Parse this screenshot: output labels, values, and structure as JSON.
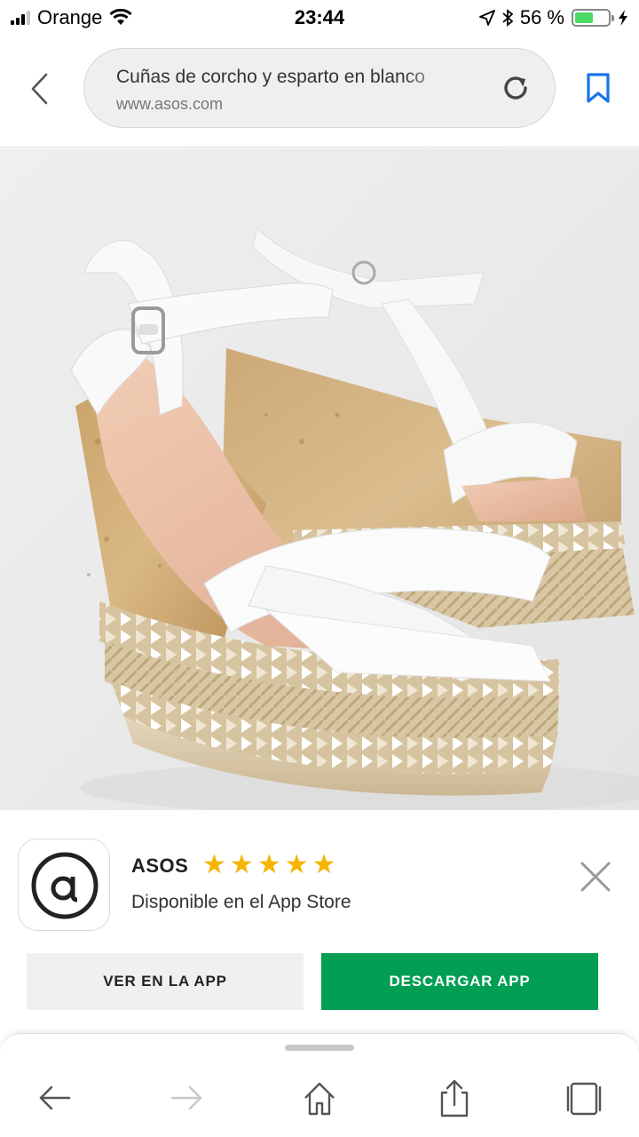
{
  "status": {
    "carrier": "Orange",
    "time": "23:44",
    "battery_pct": "56 %",
    "battery_level": 0.56,
    "battery_color": "#4cd964"
  },
  "browser": {
    "page_title": "Cuñas de corcho y esparto en blanco",
    "host": "www.asos.com",
    "icons": [
      "chevron-left-icon",
      "reload-icon",
      "bookmark-icon"
    ],
    "accent": "#1a73e8"
  },
  "product": {
    "image_icon": "product-photo-sandal"
  },
  "app_banner": {
    "app_name": "ASOS",
    "rating_stars": 5,
    "availability": "Disponible en el App Store",
    "view_label": "VER EN LA APP",
    "download_label": "DESCARGAR APP",
    "download_color": "#019e54",
    "star_color": "#f6b400"
  },
  "toolbar": {
    "icons": [
      "back-arrow-icon",
      "forward-arrow-icon",
      "home-icon",
      "share-icon",
      "tabs-icon"
    ]
  }
}
